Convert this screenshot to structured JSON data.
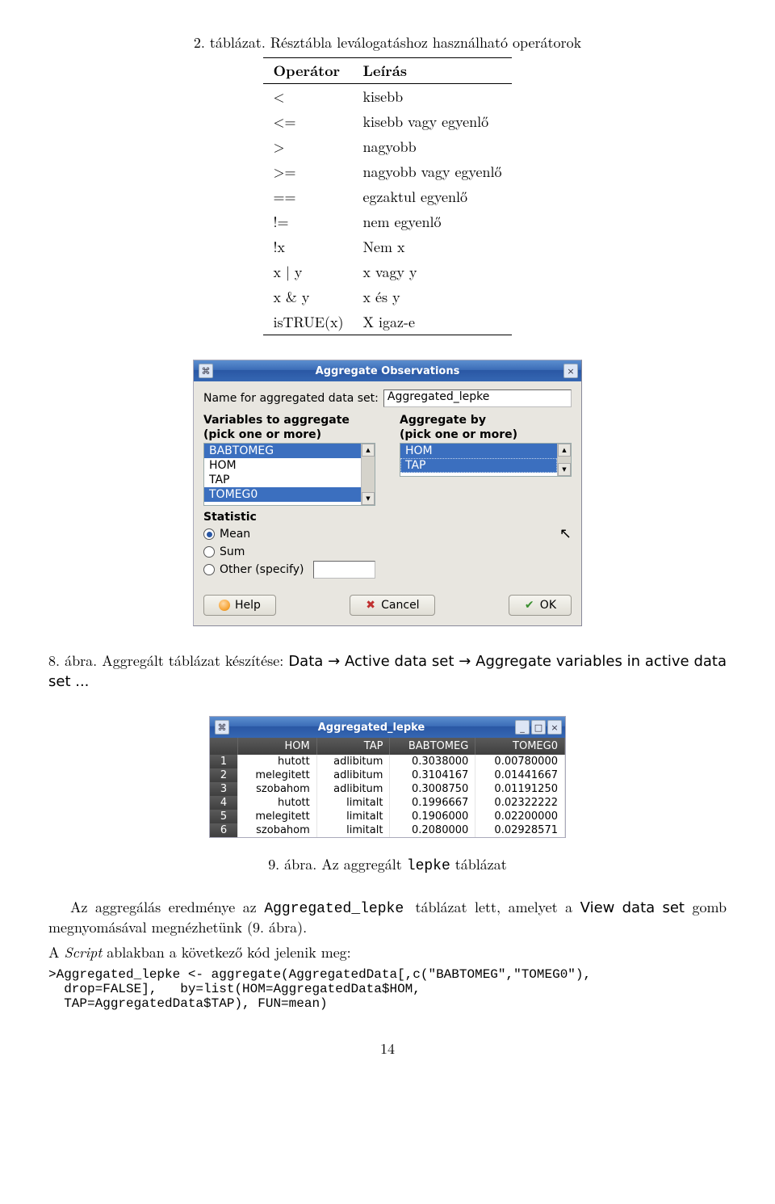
{
  "text": {
    "tableCaption": "2. táblázat. Résztábla leválogatáshoz használható operátorok",
    "opHeader1": "Operátor",
    "opHeader2": "Leírás",
    "fig8": "8. ábra. Aggregált táblázat készítése: ",
    "fig8b": "Data → Active data set → Aggregate variables in active data set ...",
    "fig9": "9. ábra. Az aggregált ",
    "fig9code": "lepke",
    "fig9b": " táblázat",
    "para1a": "Az aggregálás eredménye az ",
    "para1code": " Aggregated_lepke ",
    "para1b": "táblázat lett, amelyet a ",
    "para1sans": "View data set",
    "para1c": " gomb megnyomásával megnézhetünk (9. ábra).",
    "para2a": "A ",
    "para2i": "Script",
    "para2b": " ablakban a következő kód jelenik meg:",
    "pagenum": "14"
  },
  "operators": [
    {
      "op": "<",
      "desc": "kisebb"
    },
    {
      "op": "<=",
      "desc": "kisebb vagy egyenlő"
    },
    {
      "op": ">",
      "desc": "nagyobb"
    },
    {
      "op": ">=",
      "desc": "nagyobb vagy egyenlő"
    },
    {
      "op": "==",
      "desc": "egzaktul egyenlő"
    },
    {
      "op": "!=",
      "desc": "nem egyenlő"
    },
    {
      "op": "!x",
      "desc": "Nem x"
    },
    {
      "op": "x | y",
      "desc": "x vagy y"
    },
    {
      "op": "x & y",
      "desc": "x és y"
    },
    {
      "op": "isTRUE(x)",
      "desc": "X igaz-e"
    }
  ],
  "dialog": {
    "title": "Aggregate Observations",
    "nameLabel": "Name for aggregated data set:",
    "nameValue": "Aggregated_lepke",
    "leftLabel1": "Variables to aggregate",
    "leftLabel2": "(pick one or more)",
    "rightLabel1": "Aggregate by",
    "rightLabel2": "(pick one or more)",
    "leftItems": [
      "BABTOMEG",
      "HOM",
      "TAP",
      "TOMEG0"
    ],
    "rightItems": [
      "HOM",
      "TAP"
    ],
    "statLabel": "Statistic",
    "radios": [
      "Mean",
      "Sum",
      "Other (specify)"
    ],
    "help": "Help",
    "cancel": "Cancel",
    "ok": "OK"
  },
  "dataWindow": {
    "title": "Aggregated_lepke",
    "headers": [
      "",
      "HOM",
      "TAP",
      "BABTOMEG",
      "TOMEG0"
    ]
  },
  "chart_data": {
    "type": "table",
    "title": "Aggregated_lepke",
    "columns": [
      "HOM",
      "TAP",
      "BABTOMEG",
      "TOMEG0"
    ],
    "rows": [
      {
        "n": "1",
        "HOM": "hutott",
        "TAP": "adlibitum",
        "BABTOMEG": "0.3038000",
        "TOMEG0": "0.00780000"
      },
      {
        "n": "2",
        "HOM": "melegitett",
        "TAP": "adlibitum",
        "BABTOMEG": "0.3104167",
        "TOMEG0": "0.01441667"
      },
      {
        "n": "3",
        "HOM": "szobahom",
        "TAP": "adlibitum",
        "BABTOMEG": "0.3008750",
        "TOMEG0": "0.01191250"
      },
      {
        "n": "4",
        "HOM": "hutott",
        "TAP": "limitalt",
        "BABTOMEG": "0.1996667",
        "TOMEG0": "0.02322222"
      },
      {
        "n": "5",
        "HOM": "melegitett",
        "TAP": "limitalt",
        "BABTOMEG": "0.1906000",
        "TOMEG0": "0.02200000"
      },
      {
        "n": "6",
        "HOM": "szobahom",
        "TAP": "limitalt",
        "BABTOMEG": "0.2080000",
        "TOMEG0": "0.02928571"
      }
    ]
  },
  "code": ">Aggregated_lepke <- aggregate(AggregatedData[,c(\"BABTOMEG\",\"TOMEG0\"),\n  drop=FALSE],   by=list(HOM=AggregatedData$HOM,\n  TAP=AggregatedData$TAP), FUN=mean)"
}
